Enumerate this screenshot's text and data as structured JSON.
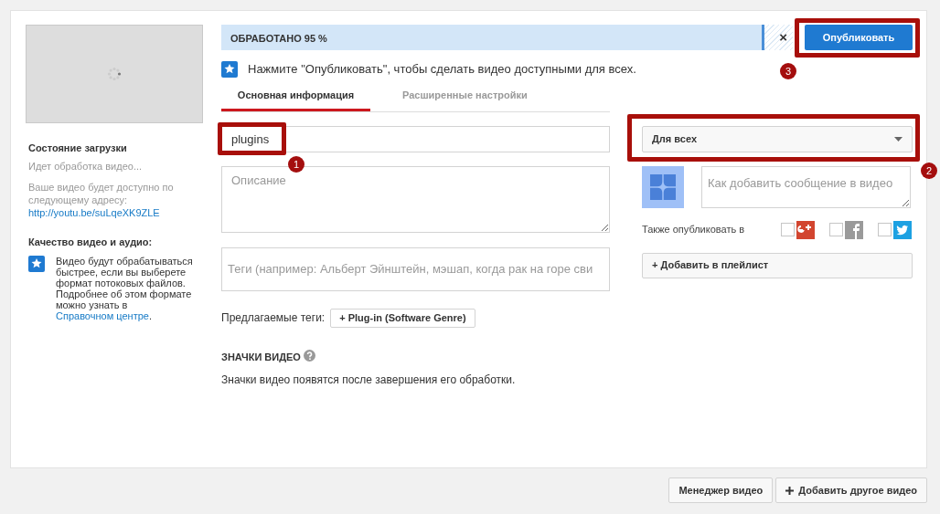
{
  "sidebar": {
    "upload_status_title": "Состояние загрузки",
    "upload_status": "Идет обработка видео...",
    "availability_note": "Ваше видео будет доступно по следующему адресу:",
    "video_link": "http://youtu.be/suLqeXK9ZLE",
    "quality_title": "Качество видео и аудио:",
    "quality_note": "Видео будут обрабатываться быстрее, если вы выберете формат потоковых файлов. Подробнее об этом формате можно узнать в",
    "quality_link": "Справочном центре",
    "quality_end": "."
  },
  "progress": {
    "label": "ОБРАБОТАНО 95 %",
    "level": 0.95,
    "close": "×"
  },
  "publish_button": "Опубликовать",
  "hint": "Нажмите \"Опубликовать\", чтобы сделать видео доступными для всех.",
  "tabs": [
    {
      "label": "Основная информация",
      "selected": true
    },
    {
      "label": "Расширенные настройки",
      "selected": false
    }
  ],
  "title_field": {
    "value": "plugins"
  },
  "description_field": {
    "placeholder": "Описание"
  },
  "tags_field": {
    "placeholder": "Теги (например: Альберт Эйнштейн, мэшап, когда рак на горе сви"
  },
  "suggested_tags": {
    "label": "Предлагаемые теги:",
    "tags": [
      "+ Plug-in (Software Genre)"
    ]
  },
  "thumbnails": {
    "title": "ЗНАЧКИ ВИДЕО",
    "note": "Значки видео появятся после завершения его обработки."
  },
  "privacy_select": {
    "value": "Для всех"
  },
  "message_field": {
    "placeholder": "Как добавить сообщение в видео"
  },
  "share": {
    "label": "Также опубликовать в",
    "networks": [
      {
        "kind": "gplus",
        "checked": false
      },
      {
        "kind": "facebook",
        "checked": false
      },
      {
        "kind": "twitter",
        "checked": false
      }
    ]
  },
  "playlist_button": "+ Добавить в плейлист",
  "annotations": [
    {
      "number": "1"
    },
    {
      "number": "2"
    },
    {
      "number": "3"
    }
  ],
  "footer_buttons": [
    {
      "kind": "plain",
      "label": "Менеджер видео"
    },
    {
      "kind": "add",
      "label": "Добавить другое видео"
    }
  ]
}
